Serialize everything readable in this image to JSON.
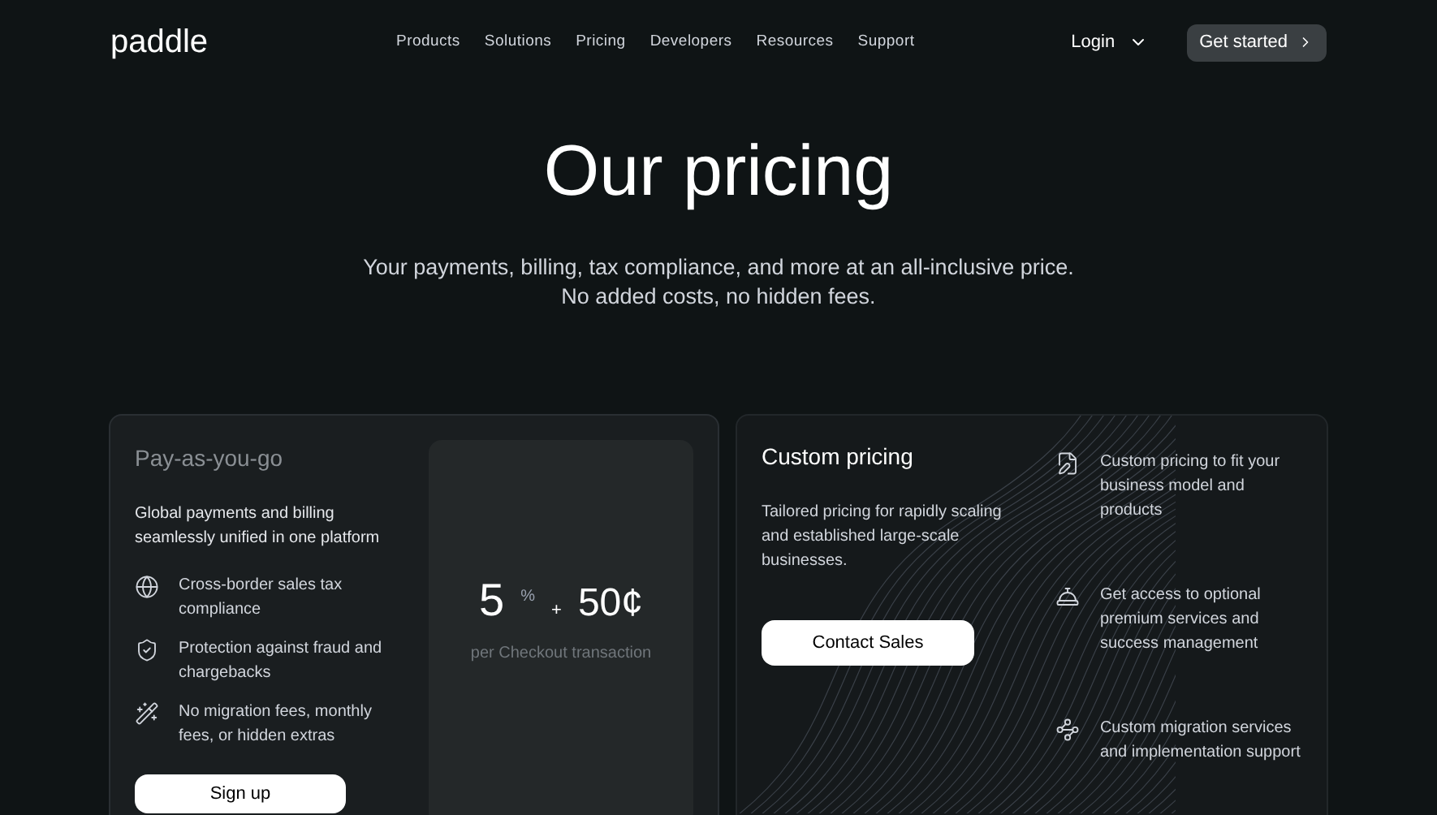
{
  "header": {
    "logo": "paddle",
    "nav": [
      {
        "label": "Products"
      },
      {
        "label": "Solutions"
      },
      {
        "label": "Pricing"
      },
      {
        "label": "Developers"
      },
      {
        "label": "Resources"
      },
      {
        "label": "Support"
      }
    ],
    "login": "Login",
    "cta": "Get started"
  },
  "hero": {
    "title": "Our pricing",
    "subtitle_lines": [
      "Your payments, billing, tax compliance, and more at an all-inclusive price.",
      "No added costs, no hidden fees."
    ]
  },
  "plans": [
    {
      "kind": "standard",
      "title": "Pay-as-you-go",
      "description": "Global payments and billing seamlessly unified in one platform",
      "features": [
        "Cross-border sales tax compliance",
        "Protection against fraud and chargebacks",
        "No migration fees, monthly fees, or hidden extras"
      ],
      "button": "Sign up",
      "price": {
        "percent_value": "5",
        "percent_sign": "%",
        "plus": "+",
        "fixed": "50¢",
        "caption": "per Checkout transaction"
      }
    },
    {
      "kind": "custom",
      "title": "Custom pricing",
      "description": "Tailored pricing for rapidly scaling and established large-scale businesses.",
      "features": [
        "Custom pricing to fit your business model and products",
        "Get access to optional premium services and success management",
        "Custom migration services and implementation support"
      ],
      "button": "Contact Sales"
    }
  ]
}
